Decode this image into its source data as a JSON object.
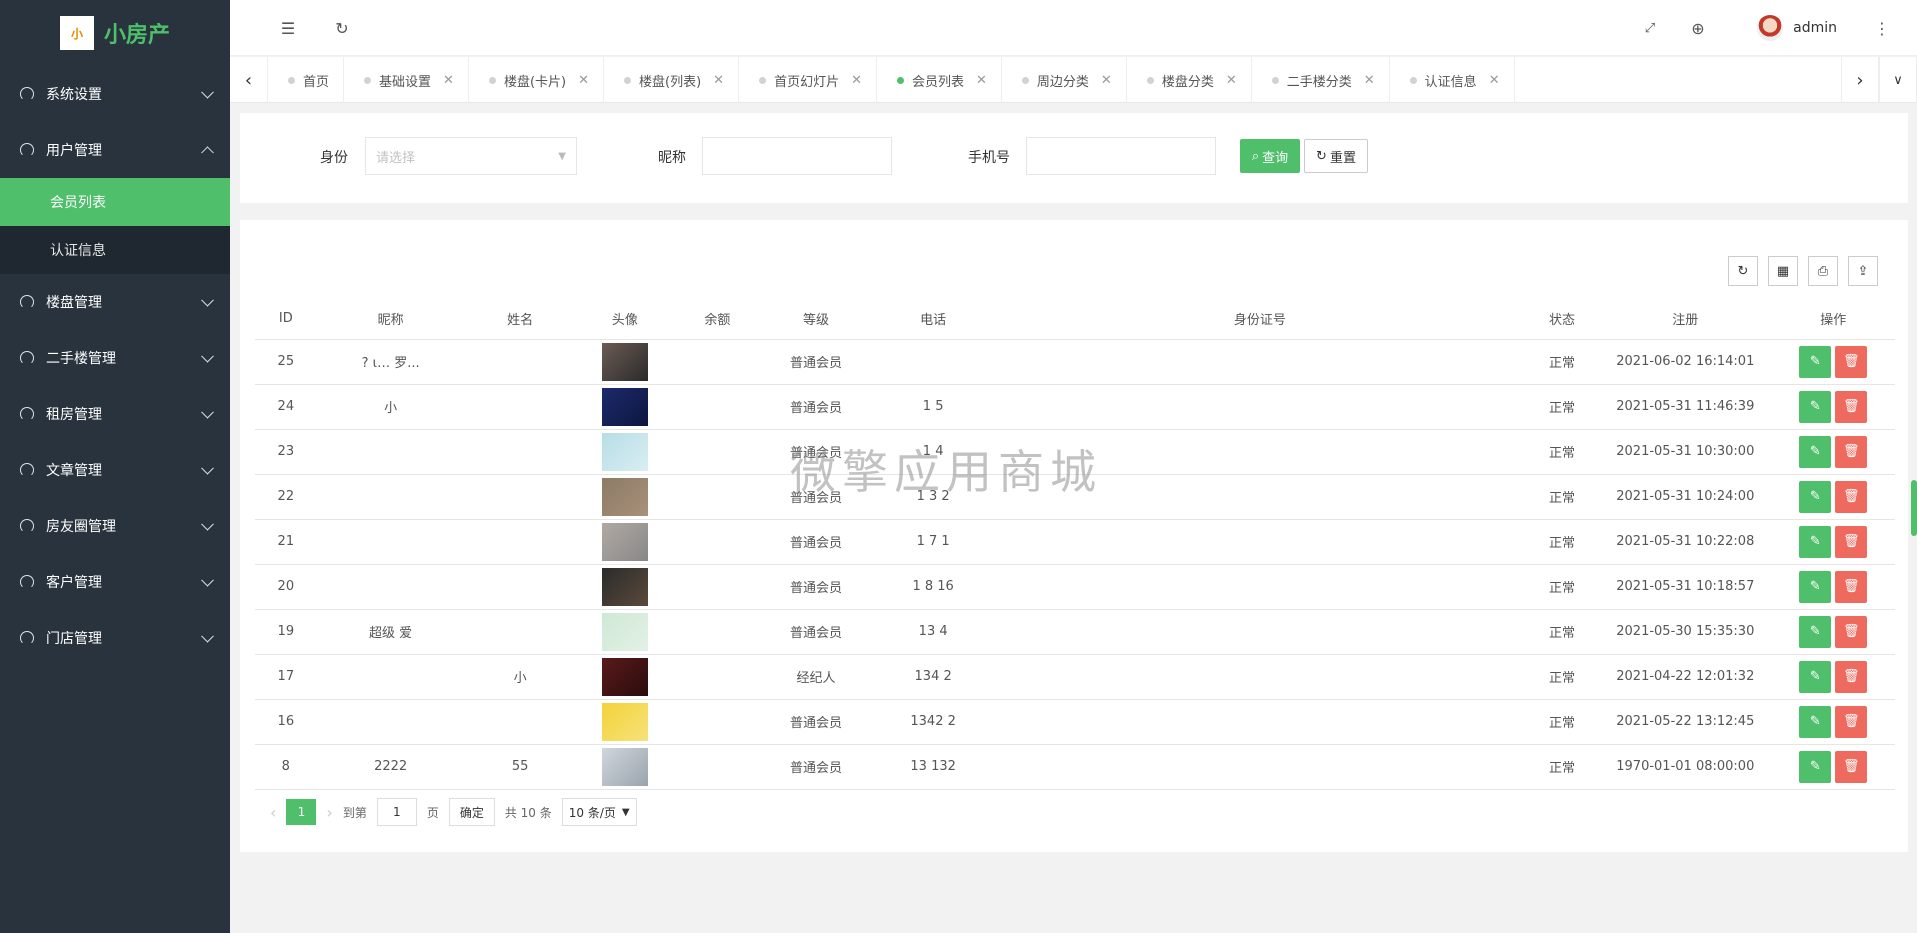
{
  "app": {
    "name": "小房产",
    "logo_text": "小"
  },
  "sidebar": {
    "groups": [
      {
        "label": "系统设置",
        "open": false
      },
      {
        "label": "用户管理",
        "open": true,
        "items": [
          {
            "label": "会员列表",
            "active": true
          },
          {
            "label": "认证信息",
            "active": false
          }
        ]
      },
      {
        "label": "楼盘管理",
        "open": false
      },
      {
        "label": "二手楼管理",
        "open": false
      },
      {
        "label": "租房管理",
        "open": false
      },
      {
        "label": "文章管理",
        "open": false
      },
      {
        "label": "房友圈管理",
        "open": false
      },
      {
        "label": "客户管理",
        "open": false
      },
      {
        "label": "门店管理",
        "open": false
      }
    ]
  },
  "topbar": {
    "user": "admin"
  },
  "tabs": [
    {
      "label": "首页",
      "active": false
    },
    {
      "label": "基础设置",
      "active": false
    },
    {
      "label": "楼盘(卡片)",
      "active": false
    },
    {
      "label": "楼盘(列表)",
      "active": false
    },
    {
      "label": "首页幻灯片",
      "active": false
    },
    {
      "label": "会员列表",
      "active": true
    },
    {
      "label": "周边分类",
      "active": false
    },
    {
      "label": "楼盘分类",
      "active": false
    },
    {
      "label": "二手楼分类",
      "active": false
    },
    {
      "label": "认证信息",
      "active": false
    }
  ],
  "filter": {
    "identity_label": "身份",
    "identity_placeholder": "请选择",
    "nickname_label": "昵称",
    "phone_label": "手机号",
    "search_label": "查询",
    "reset_label": "重置"
  },
  "table": {
    "columns": [
      "ID",
      "昵称",
      "姓名",
      "头像",
      "余额",
      "等级",
      "电话",
      "身份证号",
      "状态",
      "注册",
      "操作"
    ],
    "rows": [
      {
        "id": "25",
        "nick": "? ι… 罗...",
        "name": "",
        "level": "普通会员",
        "phone": "",
        "status": "正常",
        "reg": "2021-06-02 16:14:01",
        "ava": [
          "#6b5c54",
          "#2a2a2a"
        ]
      },
      {
        "id": "24",
        "nick": "小",
        "name": "",
        "level": "普通会员",
        "phone": "1      5",
        "status": "正常",
        "reg": "2021-05-31 11:46:39",
        "ava": [
          "#1b2a6b",
          "#0e1640"
        ]
      },
      {
        "id": "23",
        "nick": "",
        "name": "",
        "level": "普通会员",
        "phone": "1      4",
        "status": "正常",
        "reg": "2021-05-31 10:30:00",
        "ava": [
          "#b8dde6",
          "#d8eef2"
        ]
      },
      {
        "id": "22",
        "nick": "",
        "name": "",
        "level": "普通会员",
        "phone": "1  3   2",
        "status": "正常",
        "reg": "2021-05-31 10:24:00",
        "ava": [
          "#8b7b66",
          "#a9907a"
        ]
      },
      {
        "id": "21",
        "nick": "",
        "name": "",
        "level": "普通会员",
        "phone": "1  7   1",
        "status": "正常",
        "reg": "2021-05-31 10:22:08",
        "ava": [
          "#b0a9a3",
          "#888"
        ]
      },
      {
        "id": "20",
        "nick": "",
        "name": "",
        "level": "普通会员",
        "phone": "1  8   16",
        "status": "正常",
        "reg": "2021-05-31 10:18:57",
        "ava": [
          "#2b2b2b",
          "#5a4a3a"
        ]
      },
      {
        "id": "19",
        "nick": "超级   爱",
        "name": "",
        "level": "普通会员",
        "phone": "13      4",
        "status": "正常",
        "reg": "2021-05-30 15:35:30",
        "ava": [
          "#cfe8d6",
          "#e2f1e6"
        ]
      },
      {
        "id": "17",
        "nick": "",
        "name": "小",
        "level": "经纪人",
        "phone": "134     2",
        "status": "正常",
        "reg": "2021-04-22 12:01:32",
        "ava": [
          "#5a1a1a",
          "#2a0c0c"
        ]
      },
      {
        "id": "16",
        "nick": "",
        "name": "",
        "level": "普通会员",
        "phone": "1342    2",
        "status": "正常",
        "reg": "2021-05-22 13:12:45",
        "ava": [
          "#f3d23a",
          "#f7e27a"
        ]
      },
      {
        "id": "8",
        "nick": "2222",
        "name": "55",
        "level": "普通会员",
        "phone": "13     132",
        "status": "正常",
        "reg": "1970-01-01 08:00:00",
        "ava": [
          "#d0d6dc",
          "#9aa4ad"
        ]
      }
    ]
  },
  "pager": {
    "current": "1",
    "goto_label": "到第",
    "page_value": "1",
    "page_unit": "页",
    "confirm_label": "确定",
    "total_label": "共 10 条",
    "size_label": "10 条/页"
  },
  "watermark": "微擎应用商城",
  "colors": {
    "accent": "#4fbf6b",
    "sidebar": "#28333e",
    "danger": "#ee6a5e"
  }
}
